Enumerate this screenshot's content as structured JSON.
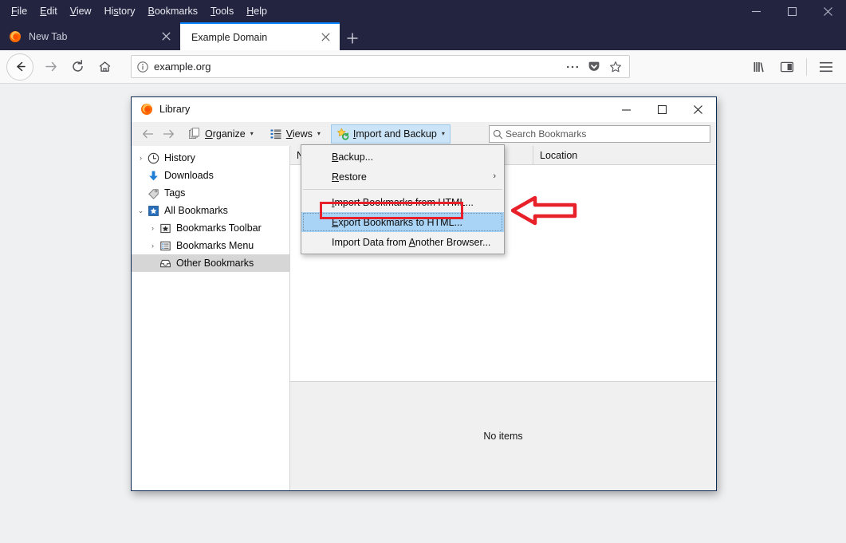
{
  "browser": {
    "menubar": [
      {
        "label": "File",
        "accel": "F"
      },
      {
        "label": "Edit",
        "accel": "E"
      },
      {
        "label": "View",
        "accel": "V"
      },
      {
        "label": "History",
        "accel": "s"
      },
      {
        "label": "Bookmarks",
        "accel": "B"
      },
      {
        "label": "Tools",
        "accel": "T"
      },
      {
        "label": "Help",
        "accel": "H"
      }
    ],
    "window_controls": {
      "minimize": "minimize-icon",
      "maximize": "maximize-icon",
      "close": "close-icon"
    },
    "tabs": [
      {
        "title": "New Tab",
        "active": false,
        "favicon": "firefox-logo-icon"
      },
      {
        "title": "Example Domain",
        "active": true,
        "favicon": "none"
      }
    ],
    "new_tab_label": "+",
    "navigation": {
      "back": "back-arrow-icon",
      "forward": "forward-arrow-icon",
      "reload": "reload-icon",
      "home": "home-icon"
    },
    "urlbar": {
      "identity_icon": "info-circle-icon",
      "value": "example.org",
      "page_actions": "ellipsis-icon",
      "pocket": "pocket-icon",
      "bookmark_star": "star-icon"
    },
    "toolbar_right": {
      "library": "library-icon",
      "sidebar": "sidebar-icon",
      "menu": "hamburger-menu-icon"
    }
  },
  "library_window": {
    "title": "Library",
    "icon": "firefox-logo-icon",
    "window_controls": {
      "minimize": "minimize-icon",
      "maximize": "maximize-icon",
      "close": "close-icon"
    },
    "toolbar": {
      "back": "back-arrow-icon",
      "forward": "forward-arrow-icon",
      "organize": {
        "label": "Organize",
        "accel": "O",
        "icon": "pages-stack-icon",
        "caret": "▾"
      },
      "views": {
        "label": "Views",
        "accel": "V",
        "icon": "list-view-icon",
        "caret": "▾"
      },
      "import_backup": {
        "label": "Import and Backup",
        "accel": "I",
        "icon": "star-sync-icon",
        "caret": "▾",
        "active": true
      }
    },
    "search": {
      "placeholder": "Search Bookmarks",
      "icon": "search-icon",
      "value": ""
    },
    "sidebar": [
      {
        "label": "History",
        "icon": "clock-icon",
        "twisty": "›",
        "indent": 0,
        "selected": false
      },
      {
        "label": "Downloads",
        "icon": "download-arrow-icon",
        "twisty": "",
        "indent": 0,
        "selected": false
      },
      {
        "label": "Tags",
        "icon": "tag-icon",
        "twisty": "",
        "indent": 0,
        "selected": false
      },
      {
        "label": "All Bookmarks",
        "icon": "bookmarks-folder-icon",
        "twisty": "⌄",
        "indent": 0,
        "selected": false
      },
      {
        "label": "Bookmarks Toolbar",
        "icon": "bookmark-star-icon",
        "twisty": "›",
        "indent": 1,
        "selected": false
      },
      {
        "label": "Bookmarks Menu",
        "icon": "bookmarks-list-icon",
        "twisty": "›",
        "indent": 1,
        "selected": false
      },
      {
        "label": "Other Bookmarks",
        "icon": "inbox-icon",
        "twisty": "",
        "indent": 1,
        "selected": true
      }
    ],
    "columns": [
      {
        "label": "Name"
      },
      {
        "label": "Location"
      }
    ],
    "empty_message": "No items"
  },
  "dropdown_menu": {
    "items": [
      {
        "label": "Backup...",
        "accel": "B",
        "type": "item",
        "highlight": false,
        "submenu": false
      },
      {
        "label": "Restore",
        "accel": "R",
        "type": "item",
        "highlight": false,
        "submenu": true,
        "submenu_arrow": "›"
      },
      {
        "type": "separator"
      },
      {
        "label": "Import Bookmarks from HTML...",
        "accel": "I",
        "type": "item",
        "highlight": false,
        "submenu": false
      },
      {
        "label": "Export Bookmarks to HTML...",
        "accel": "E",
        "type": "item",
        "highlight": true,
        "submenu": false
      },
      {
        "label": "Import Data from Another Browser...",
        "accel": "A",
        "type": "item",
        "highlight": false,
        "submenu": false
      }
    ]
  },
  "annotations": {
    "highlight_rect_color": "#e8202a",
    "arrow_color": "#e8202a",
    "arrow_direction": "left",
    "target_label": "Export Bookmarks to HTML..."
  },
  "colors": {
    "titlebar": "#232440",
    "active_tab_accent": "#0a84ff",
    "menu_highlight": "#aad4f5",
    "toolbar_active": "#cce4f7",
    "tree_selected": "#d6d6d6",
    "content_background": "#eff0f1"
  }
}
